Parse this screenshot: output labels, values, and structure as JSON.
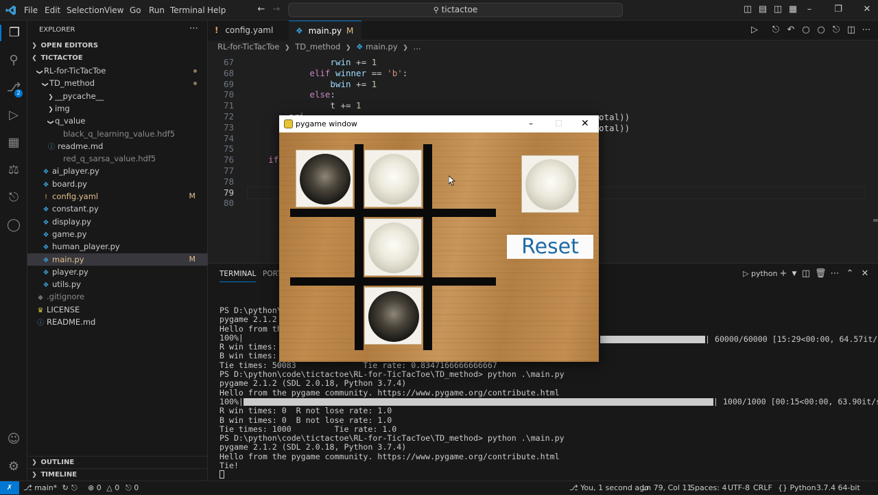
{
  "titlebar": {
    "menu": [
      "File",
      "Edit",
      "Selection",
      "View",
      "Go",
      "Run",
      "Terminal",
      "Help"
    ],
    "search": "tictactoe"
  },
  "explorer": {
    "title": "EXPLORER",
    "open_editors": "OPEN EDITORS",
    "workspace": "TICTACTOE",
    "tree": [
      {
        "label": "RL-for-TicTacToe",
        "indent": 1,
        "kind": "folder-open",
        "dot": true
      },
      {
        "label": "TD_method",
        "indent": 2,
        "kind": "folder-open",
        "dot": true
      },
      {
        "label": "__pycache__",
        "indent": 3,
        "kind": "folder"
      },
      {
        "label": "img",
        "indent": 3,
        "kind": "folder"
      },
      {
        "label": "q_value",
        "indent": 3,
        "kind": "folder-open"
      },
      {
        "label": "black_q_learning_value.hdf5",
        "indent": 4,
        "kind": "file-data"
      },
      {
        "label": "readme.md",
        "indent": 3,
        "kind": "file-info"
      },
      {
        "label": "red_q_sarsa_value.hdf5",
        "indent": 4,
        "kind": "file-data"
      },
      {
        "label": "ai_player.py",
        "indent": 2,
        "kind": "file-py"
      },
      {
        "label": "board.py",
        "indent": 2,
        "kind": "file-py"
      },
      {
        "label": "config.yaml",
        "indent": 2,
        "kind": "file-yaml",
        "badge": "M"
      },
      {
        "label": "constant.py",
        "indent": 2,
        "kind": "file-py"
      },
      {
        "label": "display.py",
        "indent": 2,
        "kind": "file-py"
      },
      {
        "label": "game.py",
        "indent": 2,
        "kind": "file-py"
      },
      {
        "label": "human_player.py",
        "indent": 2,
        "kind": "file-py"
      },
      {
        "label": "main.py",
        "indent": 2,
        "kind": "file-py",
        "badge": "M",
        "selected": true
      },
      {
        "label": "player.py",
        "indent": 2,
        "kind": "file-py"
      },
      {
        "label": "utils.py",
        "indent": 2,
        "kind": "file-py"
      },
      {
        "label": ".gitignore",
        "indent": 1,
        "kind": "file-git"
      },
      {
        "label": "LICENSE",
        "indent": 1,
        "kind": "file-license"
      },
      {
        "label": "README.md",
        "indent": 1,
        "kind": "file-info"
      }
    ],
    "outline": "OUTLINE",
    "timeline": "TIMELINE"
  },
  "tabs": [
    {
      "label": "config.yaml",
      "badge": "M",
      "icon": "yaml-icon"
    },
    {
      "label": "main.py",
      "badge": "M",
      "icon": "python-icon",
      "active": true
    }
  ],
  "breadcrumb": [
    "RL-for-TicTacToe",
    "TD_method",
    "main.py",
    "..."
  ],
  "editor": {
    "lines": [
      {
        "n": "67",
        "code": "                rwin += 1"
      },
      {
        "n": "68",
        "code": "            elif winner == 'b':"
      },
      {
        "n": "69",
        "code": "                bwin += 1"
      },
      {
        "n": "70",
        "code": "            else:"
      },
      {
        "n": "71",
        "code": "                t += 1"
      },
      {
        "n": "72",
        "code": "        pri"
      },
      {
        "n": "73",
        "code": "        pri"
      },
      {
        "n": "74",
        "code": "        pri"
      },
      {
        "n": "75",
        "code": ""
      },
      {
        "n": "76",
        "code": "    if __na"
      },
      {
        "n": "77",
        "code": "        # h"
      },
      {
        "n": "78",
        "code": "        # a"
      },
      {
        "n": "79",
        "code": "        hum"
      },
      {
        "n": "80",
        "code": "        # a"
      }
    ],
    "overflow_72": "otal))",
    "overflow_73": "otal))"
  },
  "panel": {
    "tabs": [
      "TERMINAL",
      "PORTS"
    ],
    "shell": "python",
    "terminal": [
      "PS D:\\python\\cod",
      "pygame 2.1.2 (S",
      "Hello from the",
      "100%|",
      "R win times: 72",
      "B win times: 26",
      "Tie times: 50083              Tie rate: 0.8347166666666667",
      "PS D:\\python\\code\\tictactoe\\RL-for-TicTacToe\\TD_method> python .\\main.py",
      "pygame 2.1.2 (SDL 2.0.18, Python 3.7.4)",
      "Hello from the pygame community. https://www.pygame.org/contribute.html",
      "100%|",
      "R win times: 0  R not lose rate: 1.0",
      "B win times: 0  B not lose rate: 1.0",
      "Tie times: 1000         Tie rate: 1.0",
      "PS D:\\python\\code\\tictactoe\\RL-for-TicTacToe\\TD_method> python .\\main.py",
      "pygame 2.1.2 (SDL 2.0.18, Python 3.7.4)",
      "Hello from the pygame community. https://www.pygame.org/contribute.html",
      "Tie!"
    ],
    "progress1_tail": "| 60000/60000 [15:29<00:00, 64.57it/s]",
    "progress2_tail": "| 1000/1000 [00:15<00:00, 63.90it/s]",
    "progress1_fraction": 1.0,
    "progress2_fraction": 1.0
  },
  "pygame": {
    "title": "pygame window",
    "reset_label": "Reset",
    "board": [
      [
        "b",
        "w",
        ""
      ],
      [
        "",
        "w",
        ""
      ],
      [
        "",
        "b",
        ""
      ]
    ],
    "next_stone": "w"
  },
  "statusbar": {
    "branch": "main*",
    "errors": "0",
    "warnings": "0",
    "ports": "0",
    "blame": "You, 1 second ago",
    "position": "Ln 79, Col 11",
    "spaces": "Spaces: 4",
    "encoding": "UTF-8",
    "eol": "CRLF",
    "language": "Python",
    "interpreter": "3.7.4 64-bit"
  },
  "colors": {
    "accent": "#0078d4",
    "modified": "#e2c08d",
    "reset_text": "#1f6aa5"
  }
}
